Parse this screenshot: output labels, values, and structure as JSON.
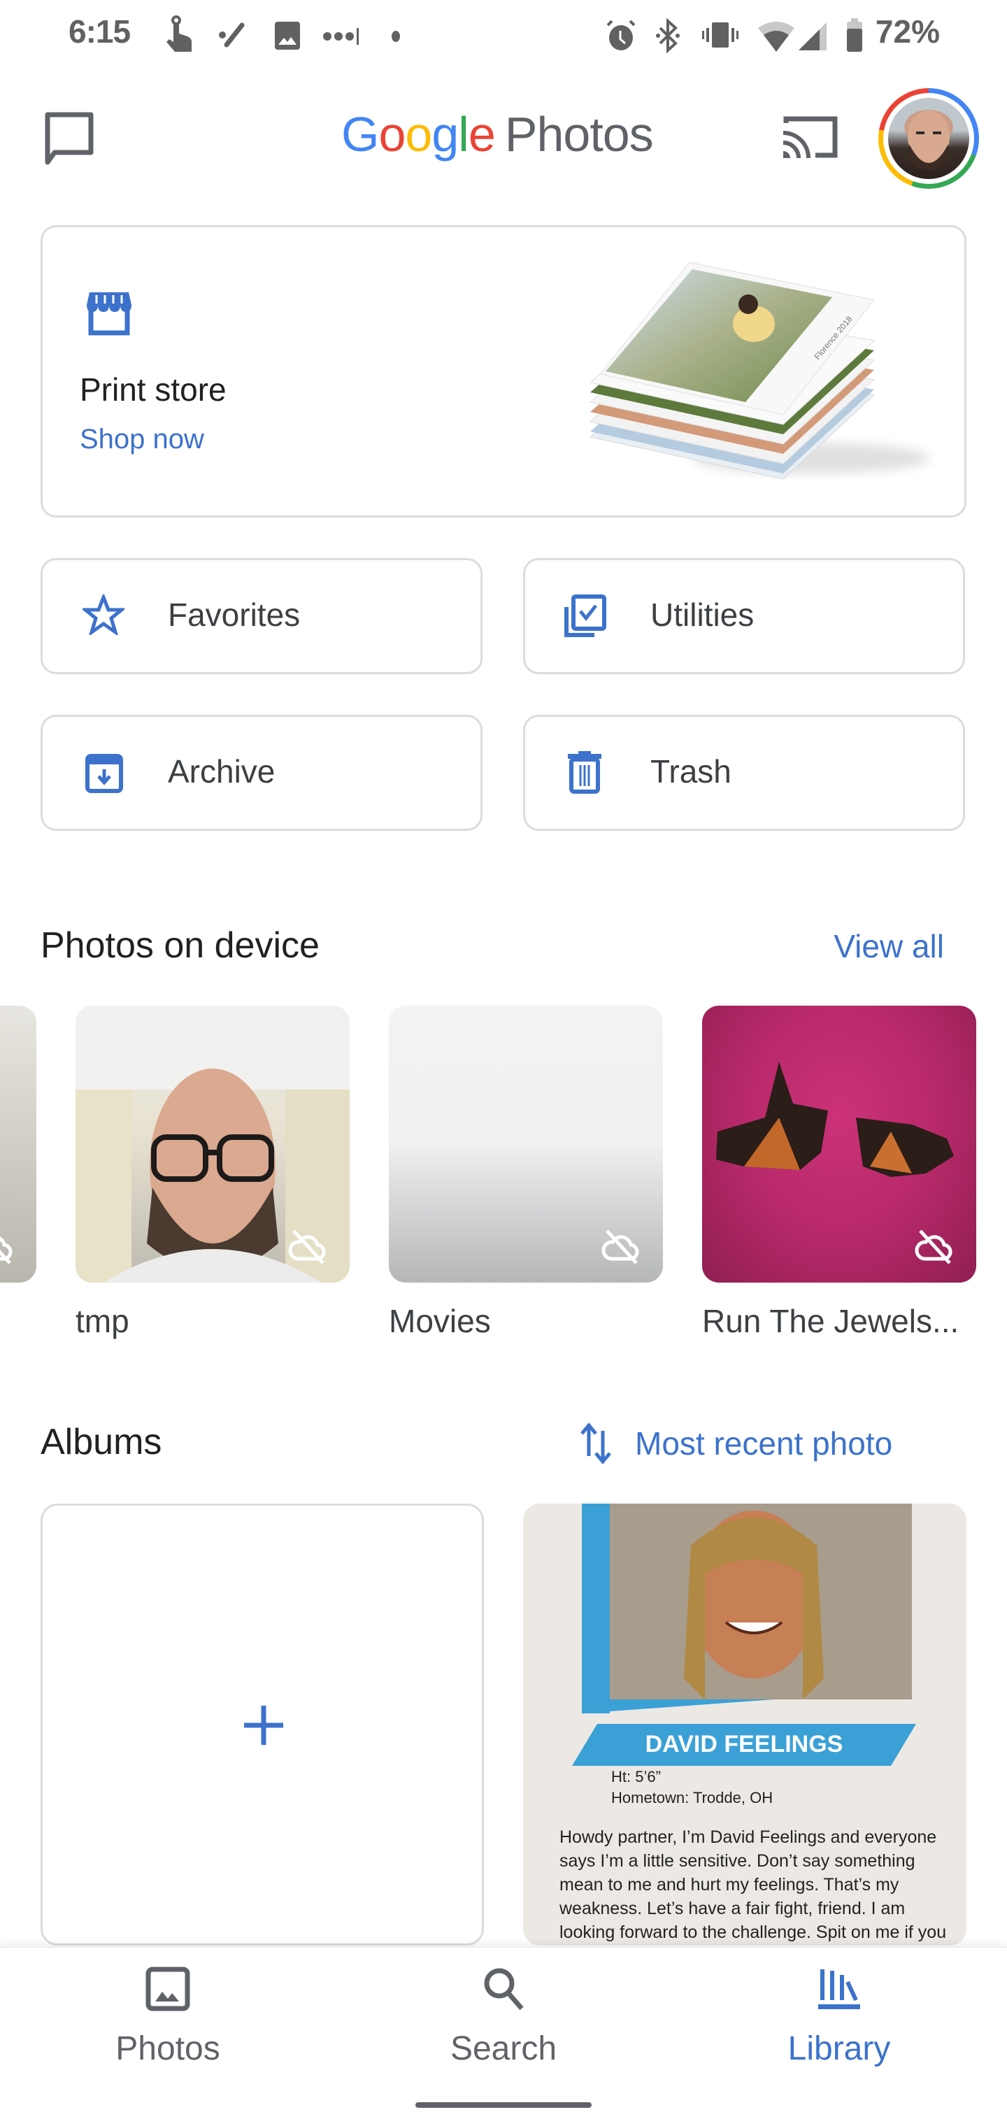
{
  "status_bar": {
    "time": "6:15",
    "battery_percent": "72%",
    "left_icons": [
      "touch-icon",
      "edit-icon",
      "image-icon",
      "signal-dots-icon",
      "dot-icon"
    ],
    "right_icons": [
      "alarm-icon",
      "bluetooth-icon",
      "vibrate-icon",
      "wifi-icon",
      "cell-signal-icon",
      "battery-icon"
    ]
  },
  "app_bar": {
    "logo_google": [
      "G",
      "o",
      "o",
      "g",
      "l",
      "e"
    ],
    "logo_product": "Photos",
    "left_icon": "message-icon",
    "right_icons": [
      "cast-icon",
      "avatar"
    ]
  },
  "print_store": {
    "icon": "storefront-icon",
    "title": "Print store",
    "link": "Shop now",
    "book_caption": "Florence 2018"
  },
  "shortcuts": [
    {
      "label": "Favorites",
      "icon": "star-icon"
    },
    {
      "label": "Utilities",
      "icon": "utilities-icon"
    },
    {
      "label": "Archive",
      "icon": "archive-icon"
    },
    {
      "label": "Trash",
      "icon": "trash-icon"
    }
  ],
  "device_section": {
    "title": "Photos on device",
    "link": "View all",
    "folders": [
      {
        "label": "tmp",
        "backup": "off"
      },
      {
        "label": "Movies",
        "backup": "off"
      },
      {
        "label": "Run The Jewels...",
        "backup": "off"
      }
    ]
  },
  "albums_section": {
    "title": "Albums",
    "sort_label": "Most recent photo",
    "create_icon": "plus-icon",
    "album_card": {
      "name": "DAVID FEELINGS",
      "height": "Ht: 5’6”",
      "hometown": "Hometown: Trodde, OH",
      "bio": "Howdy partner, I’m David Feelings and everyone says I’m a little sensitive. Don’t say something mean to me and hurt my feelings. That’s my weakness. Let’s have a fair fight, friend. I am looking forward to the challenge. Spit on me if you want to though."
    }
  },
  "bottom_nav": {
    "items": [
      {
        "label": "Photos",
        "active": false
      },
      {
        "label": "Search",
        "active": false
      },
      {
        "label": "Library",
        "active": true
      }
    ],
    "active_color": "#3c72cc",
    "inactive_color": "#5f6368"
  },
  "colors": {
    "accent": "#3c72cc",
    "border": "#dadce0",
    "text_primary": "#202124"
  }
}
